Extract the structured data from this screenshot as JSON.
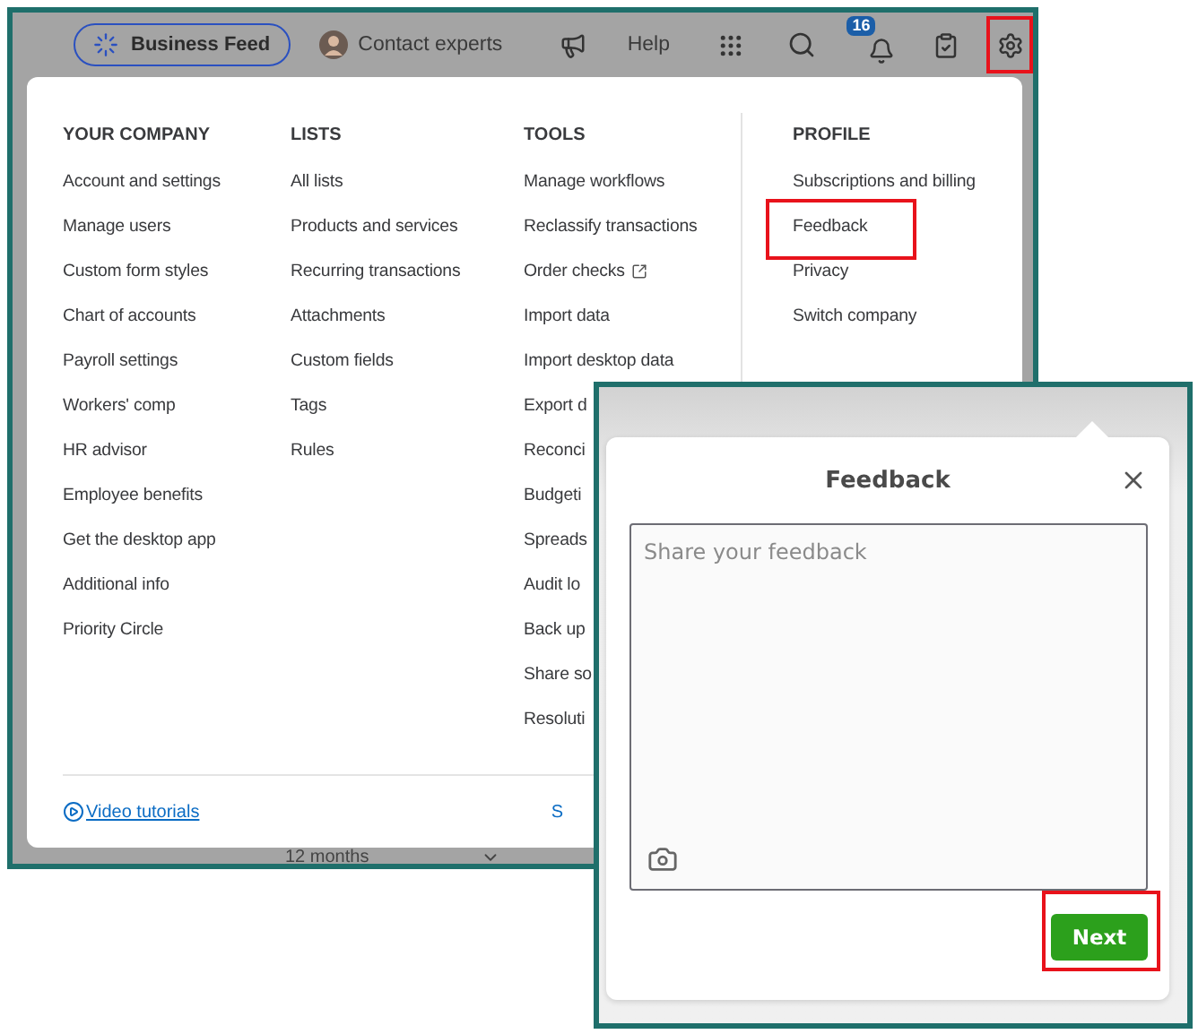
{
  "top_bar": {
    "items": [
      {
        "kind": "feed",
        "label": "Business Feed",
        "highlighted": false
      },
      {
        "kind": "experts",
        "label": "Contact experts",
        "highlighted": false
      },
      {
        "kind": "announce",
        "highlighted": false
      },
      {
        "kind": "help",
        "label": "Help",
        "highlighted": false
      },
      {
        "kind": "apps",
        "highlighted": false
      },
      {
        "kind": "search",
        "highlighted": false
      },
      {
        "kind": "notifications",
        "badge": "16",
        "highlighted": false
      },
      {
        "kind": "tasks",
        "highlighted": false
      },
      {
        "kind": "settings",
        "highlighted": true
      }
    ]
  },
  "menu": {
    "columns": [
      {
        "heading": "YOUR COMPANY",
        "items": [
          {
            "label": "Account and settings",
            "external": false,
            "highlighted": false
          },
          {
            "label": "Manage users",
            "external": false,
            "highlighted": false
          },
          {
            "label": "Custom form styles",
            "external": false,
            "highlighted": false
          },
          {
            "label": "Chart of accounts",
            "external": false,
            "highlighted": false
          },
          {
            "label": "Payroll settings",
            "external": false,
            "highlighted": false
          },
          {
            "label": "Workers' comp",
            "external": false,
            "highlighted": false
          },
          {
            "label": "HR advisor",
            "external": false,
            "highlighted": false
          },
          {
            "label": "Employee benefits",
            "external": false,
            "highlighted": false
          },
          {
            "label": "Get the desktop app",
            "external": false,
            "highlighted": false
          },
          {
            "label": "Additional info",
            "external": false,
            "highlighted": false
          },
          {
            "label": "Priority Circle",
            "external": false,
            "highlighted": false
          }
        ]
      },
      {
        "heading": "LISTS",
        "items": [
          {
            "label": "All lists",
            "external": false,
            "highlighted": false
          },
          {
            "label": "Products and services",
            "external": false,
            "highlighted": false
          },
          {
            "label": "Recurring transactions",
            "external": false,
            "highlighted": false
          },
          {
            "label": "Attachments",
            "external": false,
            "highlighted": false
          },
          {
            "label": "Custom fields",
            "external": false,
            "highlighted": false
          },
          {
            "label": "Tags",
            "external": false,
            "highlighted": false
          },
          {
            "label": "Rules",
            "external": false,
            "highlighted": false
          }
        ]
      },
      {
        "heading": "TOOLS",
        "items": [
          {
            "label": "Manage workflows",
            "external": false,
            "highlighted": false
          },
          {
            "label": "Reclassify transactions",
            "external": false,
            "highlighted": false
          },
          {
            "label": "Order checks",
            "external": true,
            "highlighted": false
          },
          {
            "label": "Import data",
            "external": false,
            "highlighted": false
          },
          {
            "label": "Import desktop data",
            "external": false,
            "highlighted": false
          },
          {
            "label": "Export d",
            "external": false,
            "highlighted": false
          },
          {
            "label": "Reconci",
            "external": false,
            "highlighted": false
          },
          {
            "label": "Budgeti",
            "external": false,
            "highlighted": false
          },
          {
            "label": "Spreads",
            "external": false,
            "highlighted": false
          },
          {
            "label": "Audit lo",
            "external": false,
            "highlighted": false
          },
          {
            "label": "Back up",
            "external": false,
            "highlighted": false
          },
          {
            "label": "Share so",
            "external": false,
            "highlighted": false
          },
          {
            "label": "Resoluti",
            "external": false,
            "highlighted": false
          }
        ]
      },
      {
        "heading": "PROFILE",
        "items": [
          {
            "label": "Subscriptions and billing",
            "external": false,
            "highlighted": false
          },
          {
            "label": "Feedback",
            "external": false,
            "highlighted": true
          },
          {
            "label": "Privacy",
            "external": false,
            "highlighted": false
          },
          {
            "label": "Switch company",
            "external": false,
            "highlighted": false
          }
        ]
      }
    ],
    "footer": {
      "link": "Video tutorials",
      "right_text": "S"
    }
  },
  "background": {
    "period": "12 months"
  },
  "feedback": {
    "title": "Feedback",
    "placeholder": "Share your feedback",
    "button": {
      "label": "Next",
      "highlighted": true
    }
  }
}
